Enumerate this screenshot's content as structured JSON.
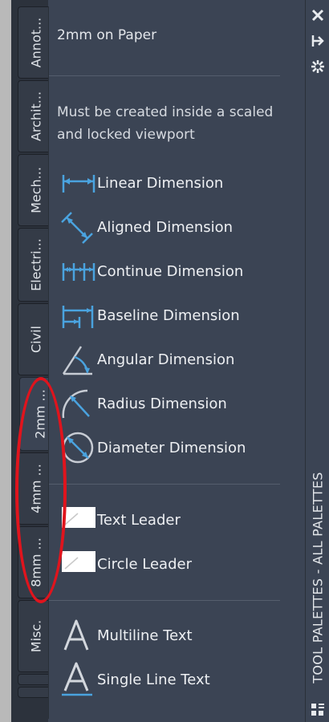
{
  "tabs": [
    {
      "label": "Annot..."
    },
    {
      "label": "Archit..."
    },
    {
      "label": "Mech..."
    },
    {
      "label": "Electri..."
    },
    {
      "label": "Civil"
    },
    {
      "label": "2mm ..."
    },
    {
      "label": "4mm ..."
    },
    {
      "label": "8mm ..."
    },
    {
      "label": "Misc."
    }
  ],
  "active_tab_index": 5,
  "palette": {
    "title": "2mm on Paper",
    "note": "Must be created inside a scaled and locked viewport",
    "dimension_tools": [
      {
        "label": "Linear Dimension",
        "icon": "linear-dimension-icon"
      },
      {
        "label": "Aligned Dimension",
        "icon": "aligned-dimension-icon"
      },
      {
        "label": "Continue Dimension",
        "icon": "continue-dimension-icon"
      },
      {
        "label": "Baseline Dimension",
        "icon": "baseline-dimension-icon"
      },
      {
        "label": "Angular Dimension",
        "icon": "angular-dimension-icon"
      },
      {
        "label": "Radius Dimension",
        "icon": "radius-dimension-icon"
      },
      {
        "label": "Diameter Dimension",
        "icon": "diameter-dimension-icon"
      }
    ],
    "leader_tools": [
      {
        "label": "Text Leader",
        "icon": "text-leader-icon"
      },
      {
        "label": "Circle Leader",
        "icon": "circle-leader-icon"
      }
    ],
    "text_tools": [
      {
        "label": "Multiline Text",
        "icon": "multiline-text-icon"
      },
      {
        "label": "Single Line Text",
        "icon": "single-line-text-icon"
      }
    ]
  },
  "title_bar": {
    "vertical_title": "TOOL PALETTES - ALL PALETTES",
    "icons": [
      "close-icon",
      "auto-hide-icon",
      "properties-icon",
      "palette-grid-icon"
    ]
  },
  "annotation": {
    "shape": "oval",
    "color": "#e0141d"
  },
  "colors": {
    "panel_bg": "#3b4454",
    "tab_bg": "#343b47",
    "accent_blue": "#4aa3df",
    "text": "#eef0f3"
  }
}
